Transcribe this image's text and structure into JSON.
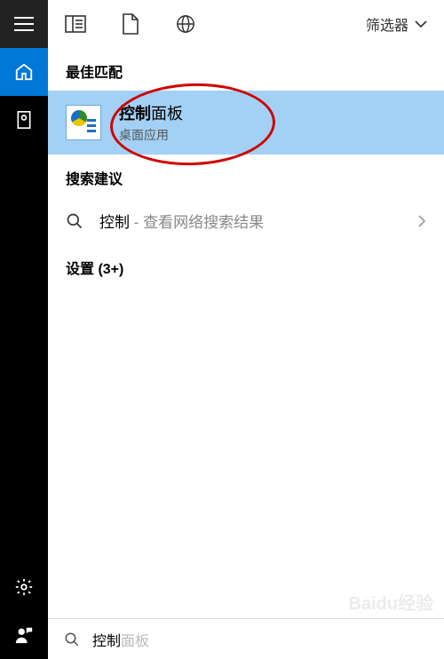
{
  "topbar": {
    "filter_label": "筛选器"
  },
  "sections": {
    "best_match": "最佳匹配",
    "search_suggestions": "搜索建议",
    "settings": "设置 (3+)"
  },
  "best_match_result": {
    "title_bold": "控制",
    "title_rest": "面板",
    "subtitle": "桌面应用"
  },
  "suggestion": {
    "query": "控制",
    "separator": " - ",
    "hint": "查看网络搜索结果"
  },
  "search": {
    "typed": "控制",
    "suggestion_tail": "面板"
  },
  "watermark": "Baidu经验"
}
